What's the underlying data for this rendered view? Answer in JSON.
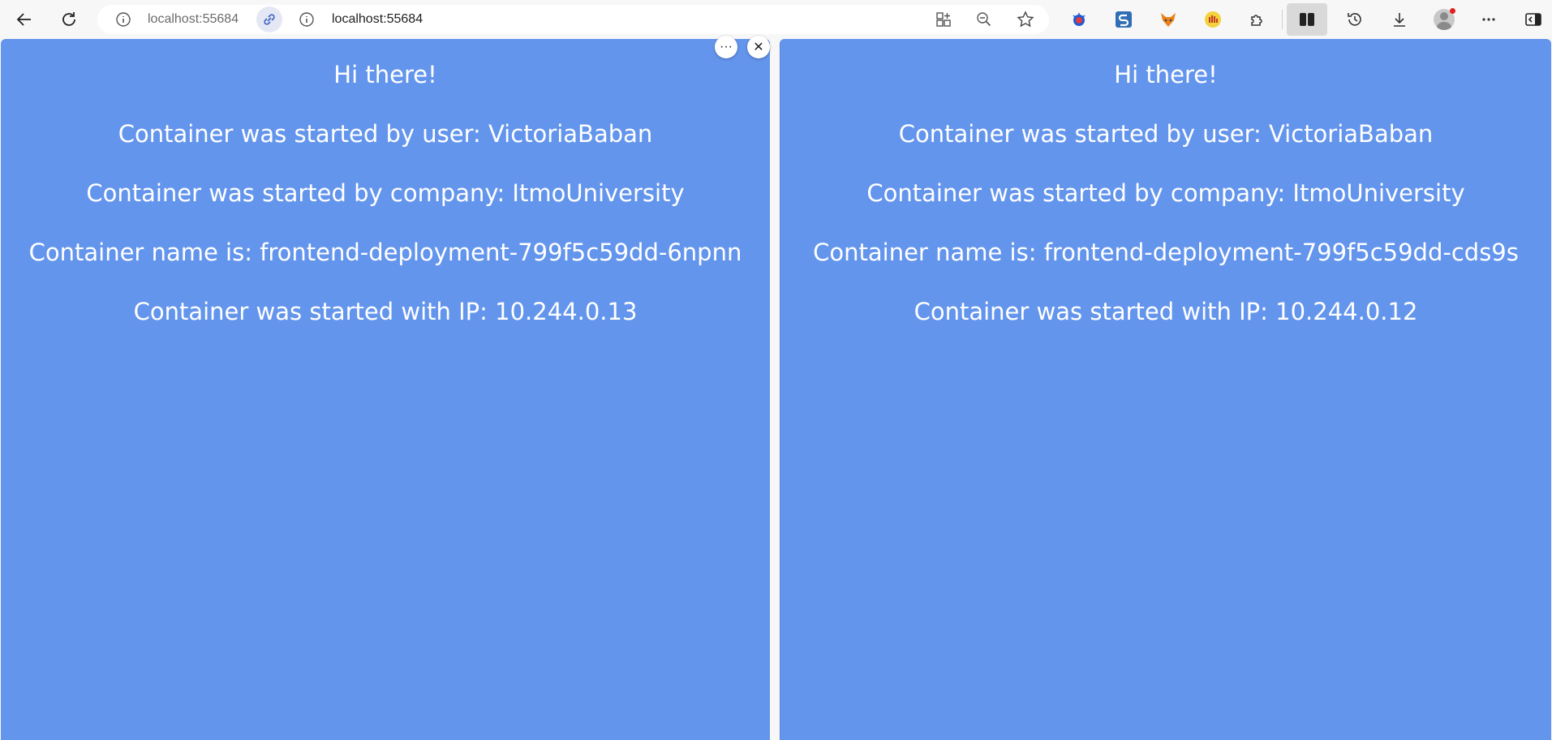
{
  "browser": {
    "address_secondary": "localhost:55684",
    "address_main": "localhost:55684"
  },
  "panes": [
    {
      "greeting": "Hi there!",
      "user_line": "Container was started by user: VictoriaBaban",
      "company_line": "Container was started by company: ItmoUniversity",
      "name_line": "Container name is: frontend-deployment-799f5c59dd-6npnn",
      "ip_line": "Container was started with IP: 10.244.0.13"
    },
    {
      "greeting": "Hi there!",
      "user_line": "Container was started by user: VictoriaBaban",
      "company_line": "Container was started by company: ItmoUniversity",
      "name_line": "Container name is: frontend-deployment-799f5c59dd-cds9s",
      "ip_line": "Container was started with IP: 10.244.0.12"
    }
  ],
  "pane_controls": {
    "more": "···",
    "close": "✕"
  },
  "colors": {
    "pane_background": "#6495ed",
    "toolbar_background": "#f7f7f7"
  }
}
